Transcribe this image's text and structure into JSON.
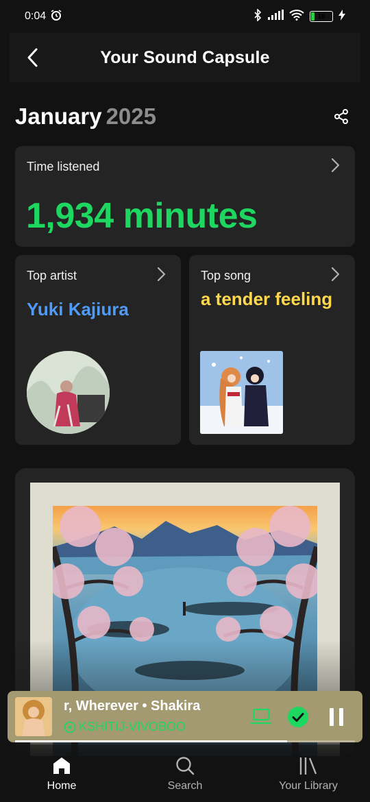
{
  "status_bar": {
    "time": "0:04",
    "battery": "16",
    "battery_level": 0.16
  },
  "header": {
    "title": "Your Sound Capsule"
  },
  "month": {
    "name": "January",
    "year": "2025"
  },
  "time_listened": {
    "label": "Time listened",
    "value": "1,934 minutes"
  },
  "top_artist": {
    "label": "Top artist",
    "name": "Yuki Kajiura"
  },
  "top_song": {
    "label": "Top song",
    "name": "a tender feeling"
  },
  "mini_player": {
    "title": "r, Wherever • Shakira",
    "device": "KSHITIJ-VIVOBOO",
    "progress": 0.8
  },
  "nav": {
    "items": [
      {
        "label": "Home"
      },
      {
        "label": "Search"
      },
      {
        "label": "Your Library"
      }
    ]
  },
  "colors": {
    "accent_green": "#1ed760",
    "artist_blue": "#509bf5",
    "song_yellow": "#ffd84d",
    "player_bg": "#a49a72"
  },
  "icons": {
    "back": "back-arrow-icon",
    "share": "share-icon",
    "chevron": "chevron-right-icon",
    "connect": "device-connect-icon",
    "saved": "check-circle-icon",
    "pause": "pause-icon",
    "home": "home-icon",
    "search": "search-icon",
    "library": "library-icon"
  }
}
